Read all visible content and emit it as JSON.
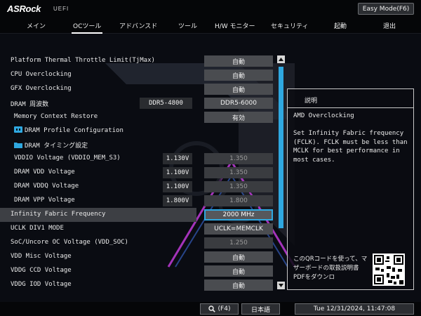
{
  "header": {
    "logo": "ASRock",
    "uefi": "UEFI",
    "easy_mode": "Easy Mode(F6)"
  },
  "nav": {
    "items": [
      "メイン",
      "OCツール",
      "アドバンスド",
      "ツール",
      "H/W モニター",
      "セキュリティ",
      "起動",
      "退出"
    ],
    "active_index": 1
  },
  "rows": [
    {
      "label": "Platform Thermal Throttle Limit(TjMax)",
      "value": "自動"
    },
    {
      "label": "CPU Overclocking",
      "value": "自動"
    },
    {
      "label": "GFX Overclocking",
      "value": "自動"
    },
    {
      "label": "DRAM 周波数",
      "current": "DDR5-4800",
      "value": "DDR5-6000"
    },
    {
      "label": "Memory Context Restore",
      "value": "有効"
    },
    {
      "label": "DRAM Profile Configuration",
      "icon": "folder-open-icon"
    },
    {
      "label": "DRAM タイミング設定",
      "icon": "folder-icon"
    },
    {
      "label": "VDDIO Voltage (VDDIO_MEM_S3)",
      "current": "1.130V",
      "value": "1.350"
    },
    {
      "label": "DRAM VDD Voltage",
      "current": "1.100V",
      "value": "1.350"
    },
    {
      "label": "DRAM VDDQ Voltage",
      "current": "1.100V",
      "value": "1.350"
    },
    {
      "label": "DRAM VPP Voltage",
      "current": "1.800V",
      "value": "1.800"
    },
    {
      "label": "Infinity Fabric Frequency",
      "value": "2000 MHz",
      "selected": true
    },
    {
      "label": "UCLK DIV1 MODE",
      "value": "UCLK=MEMCLK"
    },
    {
      "label": "SoC/Uncore OC Voltage (VDD_SOC)",
      "value": "1.250"
    },
    {
      "label": "VDD Misc Voltage",
      "value": "自動"
    },
    {
      "label": "VDDG CCD Voltage",
      "value": "自動"
    },
    {
      "label": "VDDG IOD Voltage",
      "value": "自動"
    }
  ],
  "description": {
    "title": "説明",
    "heading": "AMD Overclocking",
    "body": "Set Infinity Fabric frequency (FCLK). FCLK must be less than MCLK for best performance in most cases.",
    "qr_text": "このQRコードを使って、マザーボードの取扱説明書PDFをダウンロ"
  },
  "bottom": {
    "search": "(F4)",
    "language": "日本語",
    "datetime": "Tue 12/31/2024, 11:47:08"
  },
  "colors": {
    "accent": "#2fa8e0",
    "value_bg": "#4a4c50",
    "background": "#0a0c12"
  }
}
